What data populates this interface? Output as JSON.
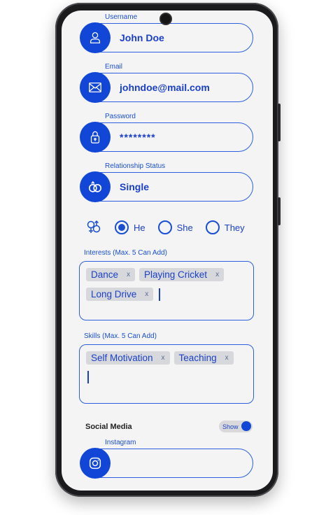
{
  "form": {
    "username": {
      "label": "Username",
      "value": "John Doe",
      "icon": "user-icon"
    },
    "email": {
      "label": "Email",
      "value": "johndoe@mail.com",
      "icon": "mail-icon"
    },
    "password": {
      "label": "Password",
      "value": "********",
      "icon": "lock-icon"
    },
    "relationship": {
      "label": "Relationship Status",
      "value": "Single",
      "icon": "rings-icon"
    },
    "gender": {
      "icon": "gender-icon",
      "options": [
        {
          "label": "He",
          "selected": true
        },
        {
          "label": "She",
          "selected": false
        },
        {
          "label": "They",
          "selected": false
        }
      ]
    },
    "interests": {
      "label": "Interests (Max. 5 Can Add)",
      "tags": [
        "Dance",
        "Playing Cricket",
        "Long Drive"
      ],
      "remove_glyph": "x"
    },
    "skills": {
      "label": "Skills (Max. 5 Can Add)",
      "tags": [
        "Self Motivation",
        "Teaching"
      ],
      "remove_glyph": "x"
    },
    "social": {
      "title": "Social Media",
      "toggle_label": "Show",
      "toggle_on": true,
      "instagram": {
        "label": "Instagram",
        "value": "",
        "icon": "instagram-icon"
      }
    }
  },
  "colors": {
    "accent": "#1246d6",
    "text_accent": "#1a3fc8",
    "background": "#f4f4f5"
  }
}
